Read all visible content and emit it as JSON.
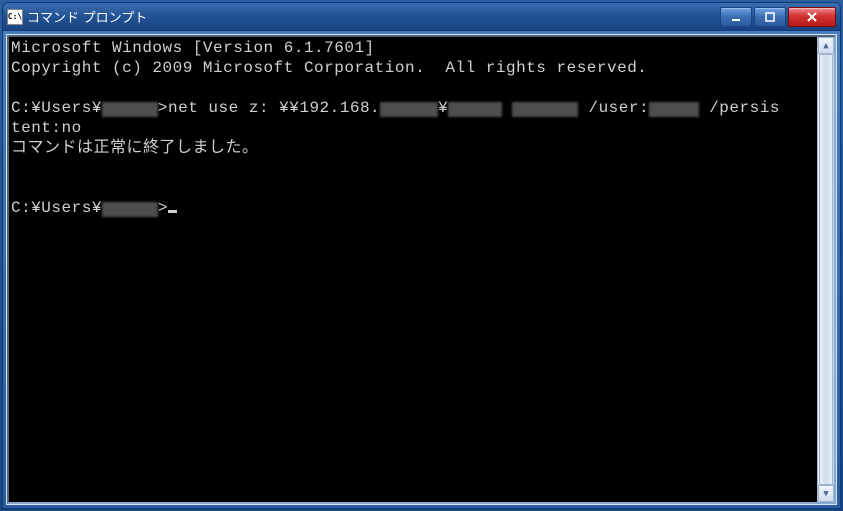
{
  "titlebar": {
    "icon_label": "C:\\",
    "title": "コマンド プロンプト"
  },
  "terminal": {
    "line1": "Microsoft Windows [Version 6.1.7601]",
    "line2": "Copyright (c) 2009 Microsoft Corporation.  All rights reserved.",
    "prompt_prefix": "C:¥Users¥",
    "cmd_start": ">net use z: ¥¥192.168.",
    "cmd_mid": " /user:",
    "cmd_end": " /persis",
    "line_cont": "tent:no",
    "result": "コマンドは正常に終了しました。",
    "prompt2_prefix": "C:¥Users¥",
    "prompt2_end": ">"
  }
}
